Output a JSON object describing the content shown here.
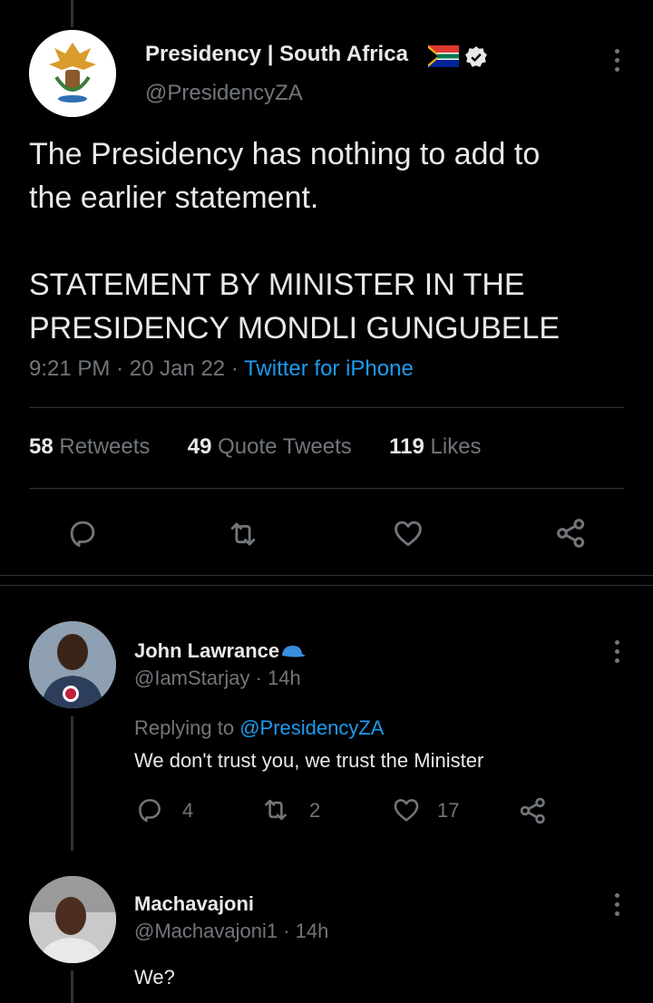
{
  "main_tweet": {
    "display_name": "Presidency | South Africa",
    "handle": "@PresidencyZA",
    "text_line1": "The Presidency has nothing to add to",
    "text_line2": "the earlier statement.",
    "statement_line1": "STATEMENT BY MINISTER IN THE",
    "statement_line2": "PRESIDENCY MONDLI GUNGUBELE",
    "time": "9:21 PM",
    "date": "20 Jan 22",
    "source": "Twitter for iPhone",
    "retweets_count": "58",
    "retweets_label": "Retweets",
    "quotes_count": "49",
    "quotes_label": "Quote Tweets",
    "likes_count": "119",
    "likes_label": "Likes"
  },
  "replies": [
    {
      "display_name": "John Lawrance",
      "handle": "@IamStarjay",
      "age": "14h",
      "replying_label": "Replying to",
      "replying_to": "@PresidencyZA",
      "text": "We don't trust you, we trust the Minister",
      "reply_count": "4",
      "retweet_count": "2",
      "like_count": "17"
    },
    {
      "display_name": "Machavajoni",
      "handle": "@Machavajoni1",
      "age": "14h",
      "text": "We?"
    }
  ],
  "colors": {
    "background": "#000000",
    "accent": "#1d9bf0",
    "muted": "#71767b",
    "text": "#e7e9ea",
    "divider": "#2f3336"
  }
}
